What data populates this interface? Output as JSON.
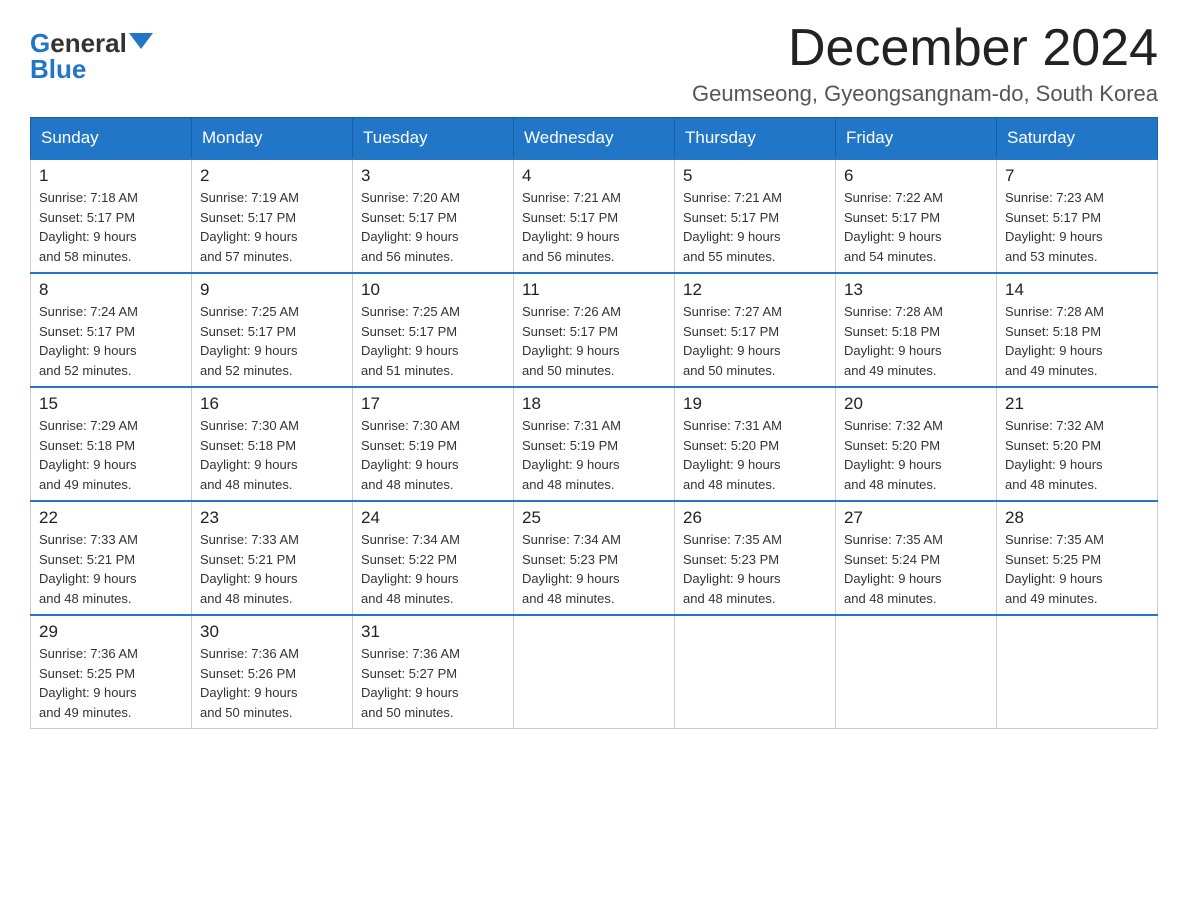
{
  "logo": {
    "general": "General",
    "blue": "Blue"
  },
  "title": "December 2024",
  "subtitle": "Geumseong, Gyeongsangnam-do, South Korea",
  "headers": [
    "Sunday",
    "Monday",
    "Tuesday",
    "Wednesday",
    "Thursday",
    "Friday",
    "Saturday"
  ],
  "weeks": [
    [
      {
        "day": "1",
        "sunrise": "7:18 AM",
        "sunset": "5:17 PM",
        "daylight": "9 hours and 58 minutes."
      },
      {
        "day": "2",
        "sunrise": "7:19 AM",
        "sunset": "5:17 PM",
        "daylight": "9 hours and 57 minutes."
      },
      {
        "day": "3",
        "sunrise": "7:20 AM",
        "sunset": "5:17 PM",
        "daylight": "9 hours and 56 minutes."
      },
      {
        "day": "4",
        "sunrise": "7:21 AM",
        "sunset": "5:17 PM",
        "daylight": "9 hours and 56 minutes."
      },
      {
        "day": "5",
        "sunrise": "7:21 AM",
        "sunset": "5:17 PM",
        "daylight": "9 hours and 55 minutes."
      },
      {
        "day": "6",
        "sunrise": "7:22 AM",
        "sunset": "5:17 PM",
        "daylight": "9 hours and 54 minutes."
      },
      {
        "day": "7",
        "sunrise": "7:23 AM",
        "sunset": "5:17 PM",
        "daylight": "9 hours and 53 minutes."
      }
    ],
    [
      {
        "day": "8",
        "sunrise": "7:24 AM",
        "sunset": "5:17 PM",
        "daylight": "9 hours and 52 minutes."
      },
      {
        "day": "9",
        "sunrise": "7:25 AM",
        "sunset": "5:17 PM",
        "daylight": "9 hours and 52 minutes."
      },
      {
        "day": "10",
        "sunrise": "7:25 AM",
        "sunset": "5:17 PM",
        "daylight": "9 hours and 51 minutes."
      },
      {
        "day": "11",
        "sunrise": "7:26 AM",
        "sunset": "5:17 PM",
        "daylight": "9 hours and 50 minutes."
      },
      {
        "day": "12",
        "sunrise": "7:27 AM",
        "sunset": "5:17 PM",
        "daylight": "9 hours and 50 minutes."
      },
      {
        "day": "13",
        "sunrise": "7:28 AM",
        "sunset": "5:18 PM",
        "daylight": "9 hours and 49 minutes."
      },
      {
        "day": "14",
        "sunrise": "7:28 AM",
        "sunset": "5:18 PM",
        "daylight": "9 hours and 49 minutes."
      }
    ],
    [
      {
        "day": "15",
        "sunrise": "7:29 AM",
        "sunset": "5:18 PM",
        "daylight": "9 hours and 49 minutes."
      },
      {
        "day": "16",
        "sunrise": "7:30 AM",
        "sunset": "5:18 PM",
        "daylight": "9 hours and 48 minutes."
      },
      {
        "day": "17",
        "sunrise": "7:30 AM",
        "sunset": "5:19 PM",
        "daylight": "9 hours and 48 minutes."
      },
      {
        "day": "18",
        "sunrise": "7:31 AM",
        "sunset": "5:19 PM",
        "daylight": "9 hours and 48 minutes."
      },
      {
        "day": "19",
        "sunrise": "7:31 AM",
        "sunset": "5:20 PM",
        "daylight": "9 hours and 48 minutes."
      },
      {
        "day": "20",
        "sunrise": "7:32 AM",
        "sunset": "5:20 PM",
        "daylight": "9 hours and 48 minutes."
      },
      {
        "day": "21",
        "sunrise": "7:32 AM",
        "sunset": "5:20 PM",
        "daylight": "9 hours and 48 minutes."
      }
    ],
    [
      {
        "day": "22",
        "sunrise": "7:33 AM",
        "sunset": "5:21 PM",
        "daylight": "9 hours and 48 minutes."
      },
      {
        "day": "23",
        "sunrise": "7:33 AM",
        "sunset": "5:21 PM",
        "daylight": "9 hours and 48 minutes."
      },
      {
        "day": "24",
        "sunrise": "7:34 AM",
        "sunset": "5:22 PM",
        "daylight": "9 hours and 48 minutes."
      },
      {
        "day": "25",
        "sunrise": "7:34 AM",
        "sunset": "5:23 PM",
        "daylight": "9 hours and 48 minutes."
      },
      {
        "day": "26",
        "sunrise": "7:35 AM",
        "sunset": "5:23 PM",
        "daylight": "9 hours and 48 minutes."
      },
      {
        "day": "27",
        "sunrise": "7:35 AM",
        "sunset": "5:24 PM",
        "daylight": "9 hours and 48 minutes."
      },
      {
        "day": "28",
        "sunrise": "7:35 AM",
        "sunset": "5:25 PM",
        "daylight": "9 hours and 49 minutes."
      }
    ],
    [
      {
        "day": "29",
        "sunrise": "7:36 AM",
        "sunset": "5:25 PM",
        "daylight": "9 hours and 49 minutes."
      },
      {
        "day": "30",
        "sunrise": "7:36 AM",
        "sunset": "5:26 PM",
        "daylight": "9 hours and 50 minutes."
      },
      {
        "day": "31",
        "sunrise": "7:36 AM",
        "sunset": "5:27 PM",
        "daylight": "9 hours and 50 minutes."
      },
      null,
      null,
      null,
      null
    ]
  ],
  "labels": {
    "sunrise": "Sunrise:",
    "sunset": "Sunset:",
    "daylight": "Daylight:"
  }
}
